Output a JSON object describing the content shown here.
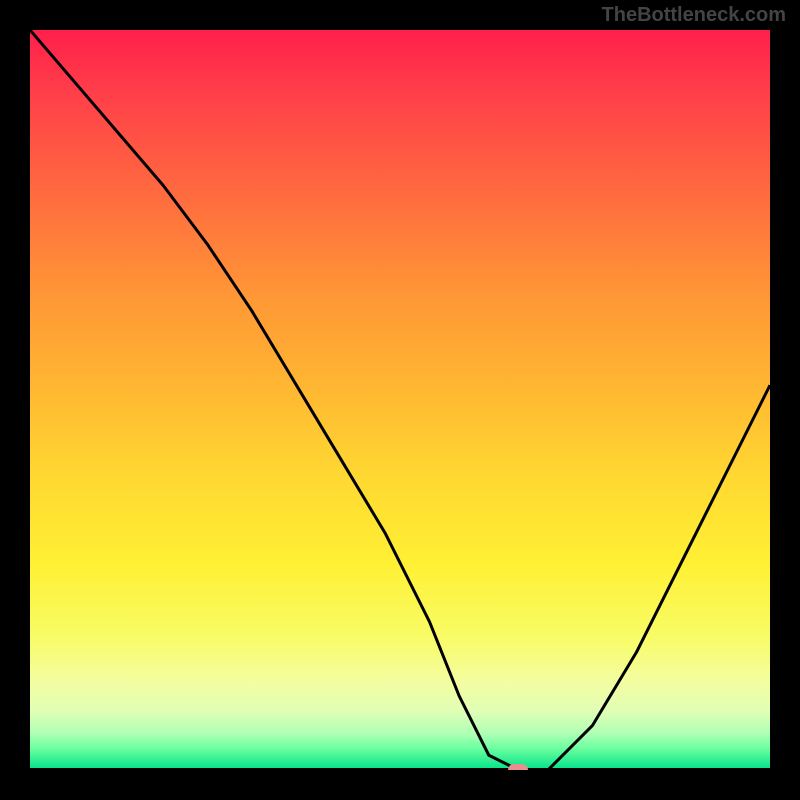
{
  "watermark": "TheBottleneck.com",
  "chart_data": {
    "type": "line",
    "title": "",
    "xlabel": "",
    "ylabel": "",
    "xlim": [
      0,
      100
    ],
    "ylim": [
      0,
      100
    ],
    "series": [
      {
        "name": "curve",
        "x": [
          0,
          6,
          12,
          18,
          24,
          30,
          36,
          42,
          48,
          54,
          58,
          62,
          66,
          70,
          76,
          82,
          88,
          94,
          100
        ],
        "y": [
          100,
          93,
          86,
          79,
          71,
          62,
          52,
          42,
          32,
          20,
          10,
          2,
          0,
          0,
          6,
          16,
          28,
          40,
          52
        ]
      }
    ],
    "marker": {
      "x": 66,
      "y": 0
    }
  }
}
